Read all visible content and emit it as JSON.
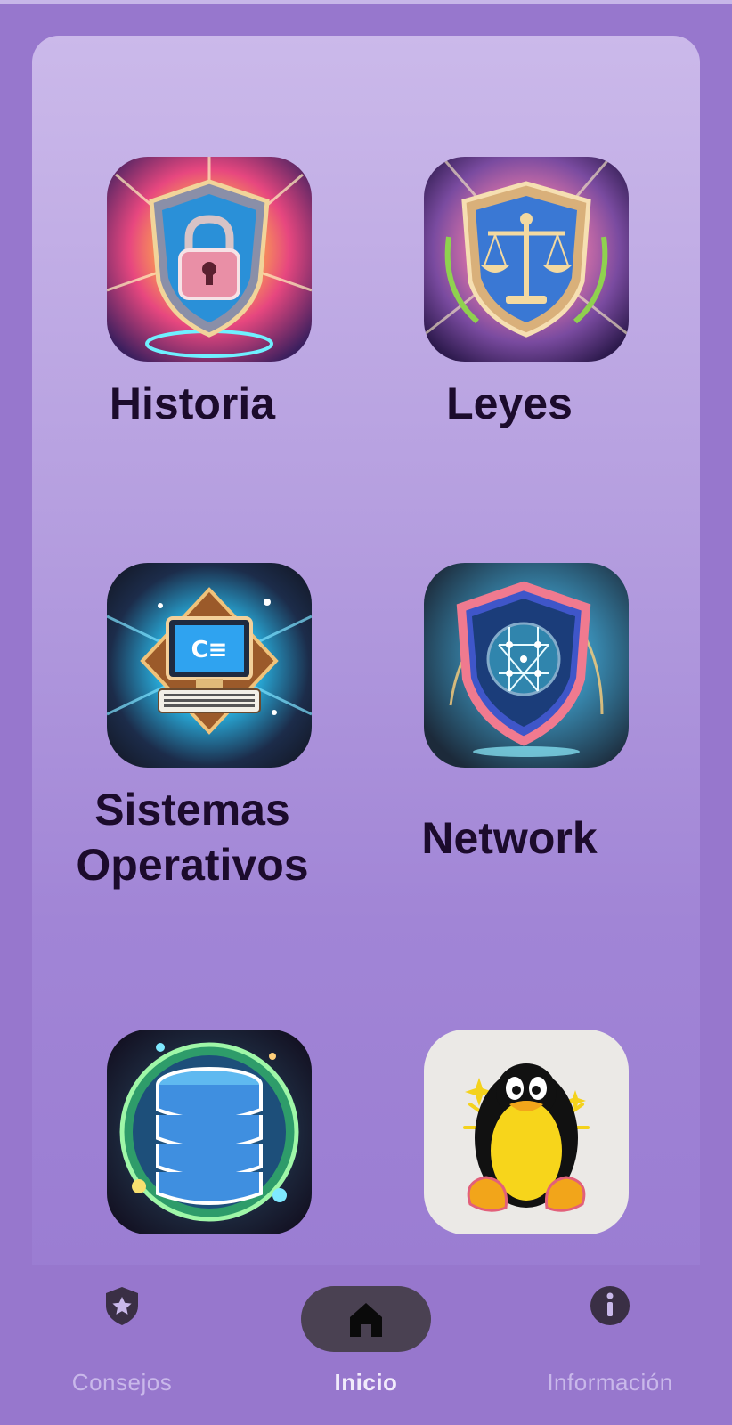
{
  "grid": {
    "items": [
      {
        "label": "Historia",
        "icon": "shield-lock-icon"
      },
      {
        "label": "Leyes",
        "icon": "scales-shield-icon"
      },
      {
        "label": "Sistemas\nOperativos",
        "icon": "computer-icon"
      },
      {
        "label": "Network",
        "icon": "network-shield-icon"
      },
      {
        "label": "",
        "icon": "database-icon"
      },
      {
        "label": "",
        "icon": "linux-penguin-icon"
      }
    ]
  },
  "bottom_nav": {
    "items": [
      {
        "label": "Consejos",
        "icon": "shield-star-icon",
        "active": false
      },
      {
        "label": "Inicio",
        "icon": "home-icon",
        "active": true
      },
      {
        "label": "Información",
        "icon": "info-icon",
        "active": false
      }
    ]
  },
  "colors": {
    "background": "#9777cd",
    "panel": "#b49ddf",
    "label_text": "#1c0b2c",
    "nav_pill": "#4a4152",
    "nav_label": "#c9b8ea"
  }
}
